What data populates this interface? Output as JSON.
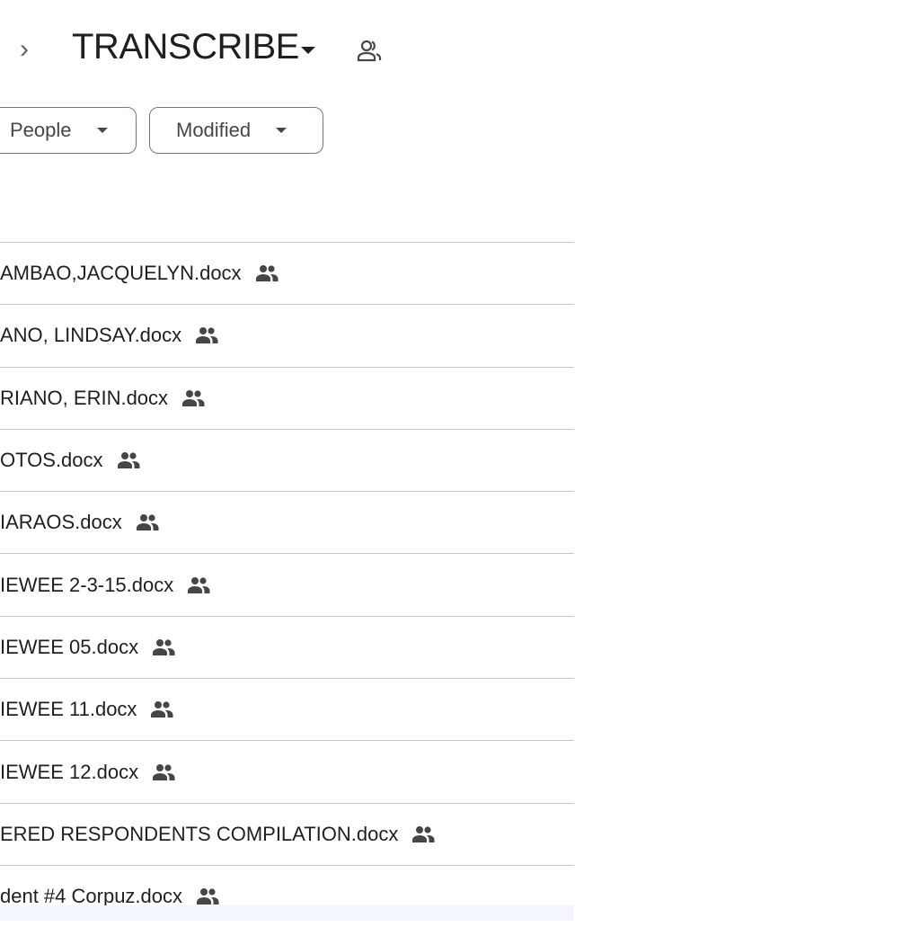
{
  "header": {
    "breadcrumb_separator": "›",
    "folder_title": "TRANSCRIBE",
    "shared_icon": "people-outline-icon"
  },
  "filters": [
    {
      "label": "People"
    },
    {
      "label": "Modified"
    }
  ],
  "files": [
    {
      "name": "AMBAO,JACQUELYN.docx",
      "shared": true
    },
    {
      "name": "ANO, LINDSAY.docx",
      "shared": true
    },
    {
      "name": "RIANO, ERIN.docx",
      "shared": true
    },
    {
      "name": "OTOS.docx",
      "shared": true
    },
    {
      "name": "IARAOS.docx",
      "shared": true
    },
    {
      "name": "IEWEE 2-3-15.docx",
      "shared": true
    },
    {
      "name": "IEWEE 05.docx",
      "shared": true
    },
    {
      "name": "IEWEE 11.docx",
      "shared": true
    },
    {
      "name": "IEWEE 12.docx",
      "shared": true
    },
    {
      "name": "ERED RESPONDENTS COMPILATION.docx",
      "shared": true
    },
    {
      "name": "dent #4  Corpuz.docx",
      "shared": true
    }
  ]
}
